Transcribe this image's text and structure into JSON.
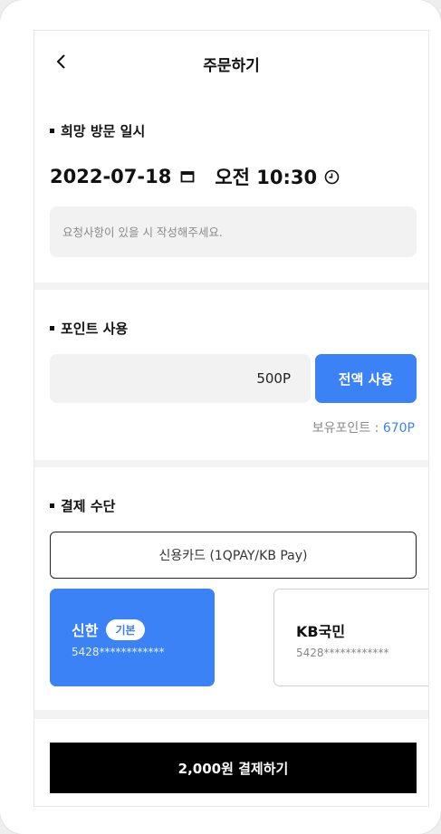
{
  "header": {
    "title": "주문하기",
    "back_icon": "chevron-left-icon"
  },
  "visit": {
    "section_title": "희망 방문 일시",
    "date": "2022-07-18",
    "time": "오전 10:30",
    "request_placeholder": "요청사항이 있을 시 작성해주세요."
  },
  "points": {
    "section_title": "포인트 사용",
    "value": "500P",
    "use_all_label": "전액 사용",
    "owned_label": "보유포인트 :",
    "owned_value": "670P"
  },
  "payment": {
    "section_title": "결제 수단",
    "method_label": "신용카드 (1QPAY/KB Pay)",
    "cards": [
      {
        "name": "신한",
        "badge": "기본",
        "number": "5428************"
      },
      {
        "name": "KB국민",
        "number": "5428************"
      }
    ]
  },
  "pay_button": {
    "label": "2,000원 결제하기"
  },
  "colors": {
    "accent": "#3b82f6",
    "primary_button": "#000000"
  }
}
